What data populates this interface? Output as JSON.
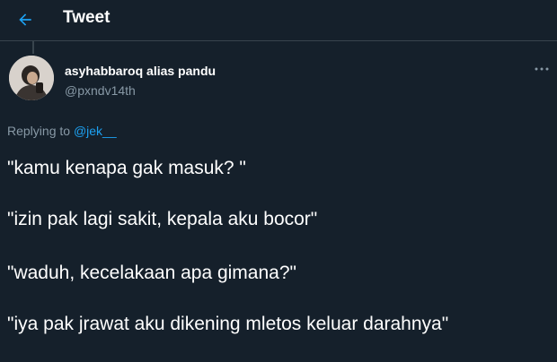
{
  "header": {
    "title": "Tweet",
    "back_icon": "arrow-left-icon",
    "accent_color": "#1da1f2"
  },
  "author": {
    "display_name": "asyhabbaroq alias pandu",
    "handle": "@pxndv14th"
  },
  "more_icon": "more-horizontal-icon",
  "reply": {
    "prefix": "Replying to ",
    "mention": "@jek__"
  },
  "tweet": {
    "lines": [
      "\"kamu kenapa gak masuk? \"",
      "\"izin pak lagi sakit, kepala aku bocor\"",
      "\"waduh, kecelakaan apa gimana?\"",
      "\"iya pak jrawat aku dikening mletos keluar darahnya\""
    ]
  },
  "colors": {
    "background": "#15202b",
    "text_primary": "#ffffff",
    "text_secondary": "#8899a6",
    "link": "#1da1f2",
    "divider": "#38444d"
  }
}
